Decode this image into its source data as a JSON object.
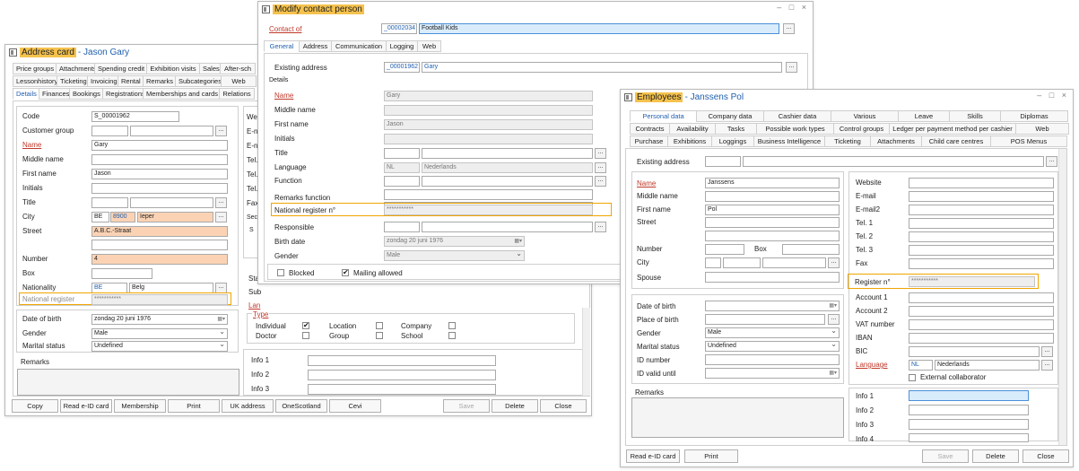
{
  "address_card": {
    "title_hl": "Address card",
    "title_rest": "- Jason Gary",
    "tabs_row1": [
      "Price groups",
      "Attachments",
      "Spending credit",
      "Exhibition visits",
      "Sales",
      "After-sch"
    ],
    "tabs_row2": [
      "Lessonhistory",
      "Ticketing",
      "Invoicing",
      "Rental",
      "Remarks",
      "Subcategories",
      "Web"
    ],
    "tabs_row3": [
      "Details",
      "Finances",
      "Bookings",
      "Registrations",
      "Memberships and cards",
      "Relations"
    ],
    "labels": {
      "code": "Code",
      "customer_group": "Customer group",
      "name": "Name",
      "middle_name": "Middle name",
      "first_name": "First name",
      "initials": "Initials",
      "title": "Title",
      "city": "City",
      "street": "Street",
      "number": "Number",
      "box": "Box",
      "nationality": "Nationality",
      "national_register": "National register",
      "dob": "Date of birth",
      "gender": "Gender",
      "marital": "Marital status",
      "remarks": "Remarks"
    },
    "values": {
      "code": "S_00001962",
      "name": "Gary",
      "first_name": "Jason",
      "city_country": "BE",
      "city_zip": "8900",
      "city_name": "Ieper",
      "street": "A.B.C.-Straat",
      "number": "4",
      "nationality_code": "BE",
      "nationality_name": "Belg",
      "national_register": "***********",
      "dob": "zondag 20 juni 1976",
      "gender": "Male",
      "marital": "Undefined"
    },
    "right_labels": [
      "We",
      "E-n",
      "E-n",
      "Tel.",
      "Tel.",
      "Tel.",
      "Fax"
    ],
    "right_section": "Seco",
    "right_s": "S",
    "stat_labels": [
      "Stat",
      "Sub",
      "Lan"
    ],
    "type_label": "Type",
    "type_items": [
      "Individual",
      "Location",
      "Company",
      "Doctor",
      "Group",
      "School"
    ],
    "info_labels": [
      "Info 1",
      "Info 2",
      "Info 3"
    ],
    "buttons": [
      "Copy",
      "Read e-ID card",
      "Membership",
      "Print",
      "UK address",
      "OneScotland",
      "Cevi",
      "Save",
      "Delete",
      "Close"
    ]
  },
  "modify_contact": {
    "title_hl": "Modify contact person",
    "contact_of_label": "Contact of",
    "contact_of_code": "_00002034",
    "contact_of_name": "Football Kids",
    "tabs": [
      "General",
      "Address",
      "Communication",
      "Logging",
      "Web"
    ],
    "existing_address_label": "Existing address",
    "existing_code": "_00001962",
    "existing_name": "Gary",
    "details_label": "Details",
    "labels": {
      "name": "Name",
      "middle_name": "Middle name",
      "first_name": "First name",
      "initials": "Initials",
      "title": "Title",
      "language": "Language",
      "function": "Function",
      "remarks_function": "Remarks function",
      "national_register": "National register n°",
      "responsible": "Responsible",
      "birth_date": "Birth date",
      "gender": "Gender"
    },
    "values": {
      "name": "Gary",
      "first_name": "Jason",
      "language_code": "NL",
      "language_name": "Nederlands",
      "national_register": "***********",
      "birth_date": "zondag 20 juni 1976",
      "gender": "Male"
    },
    "blocked_label": "Blocked",
    "mailing_label": "Mailing allowed"
  },
  "employees": {
    "title_hl": "Employees",
    "title_rest": "- Janssens Pol",
    "tabs_row1": [
      "Personal data",
      "Company data",
      "Cashier data",
      "Various",
      "Leave",
      "Skills",
      "Diplomas"
    ],
    "tabs_row2": [
      "Contracts",
      "Availability",
      "Tasks",
      "Possible work types",
      "Control groups",
      "Ledger per payment method per cashier",
      "Web"
    ],
    "tabs_row3": [
      "Purchase",
      "Exhibitions",
      "Loggings",
      "Business Intelligence",
      "Ticketing",
      "Attachments",
      "Child care centres",
      "POS Menus"
    ],
    "existing_address_label": "Existing address",
    "labels": {
      "name": "Name",
      "middle_name": "Middle name",
      "first_name": "First name",
      "street": "Street",
      "number": "Number",
      "box": "Box",
      "city": "City",
      "spouse": "Spouse",
      "dob": "Date of birth",
      "place_of_birth": "Place of birth",
      "gender": "Gender",
      "marital": "Marital status",
      "id_number": "ID number",
      "id_valid": "ID valid until",
      "remarks": "Remarks"
    },
    "values": {
      "name": "Janssens",
      "first_name": "Pol",
      "gender": "Male",
      "marital": "Undefined",
      "lang_code": "NL",
      "lang_name": "Nederlands",
      "register": "***********"
    },
    "right_labels": {
      "website": "Website",
      "email": "E-mail",
      "email2": "E-mail2",
      "tel1": "Tel. 1",
      "tel2": "Tel. 2",
      "tel3": "Tel. 3",
      "fax": "Fax",
      "register": "Register n°",
      "account1": "Account 1",
      "account2": "Account 2",
      "vat": "VAT number",
      "iban": "IBAN",
      "bic": "BIC",
      "language": "Language",
      "external": "External collaborator"
    },
    "info_labels": [
      "Info 1",
      "Info 2",
      "Info 3",
      "Info 4"
    ],
    "buttons": [
      "Read e-ID card",
      "Print",
      "Save",
      "Delete",
      "Close"
    ]
  }
}
